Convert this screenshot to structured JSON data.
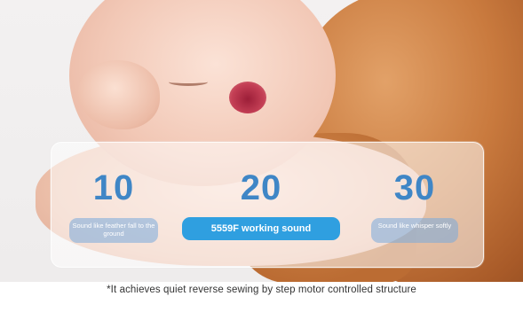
{
  "stats": [
    {
      "value": "10",
      "label": "Sound like feather fall to the ground"
    },
    {
      "value": "20",
      "label": "5559F working sound"
    },
    {
      "value": "30",
      "label": "Sound like whisper softly"
    }
  ],
  "caption": "*It achieves quiet reverse sewing by step motor controlled structure",
  "colors": {
    "accent": "#3f86c6",
    "highlight_pill": "#2f9fe0",
    "blanket": "#c97a3e"
  }
}
